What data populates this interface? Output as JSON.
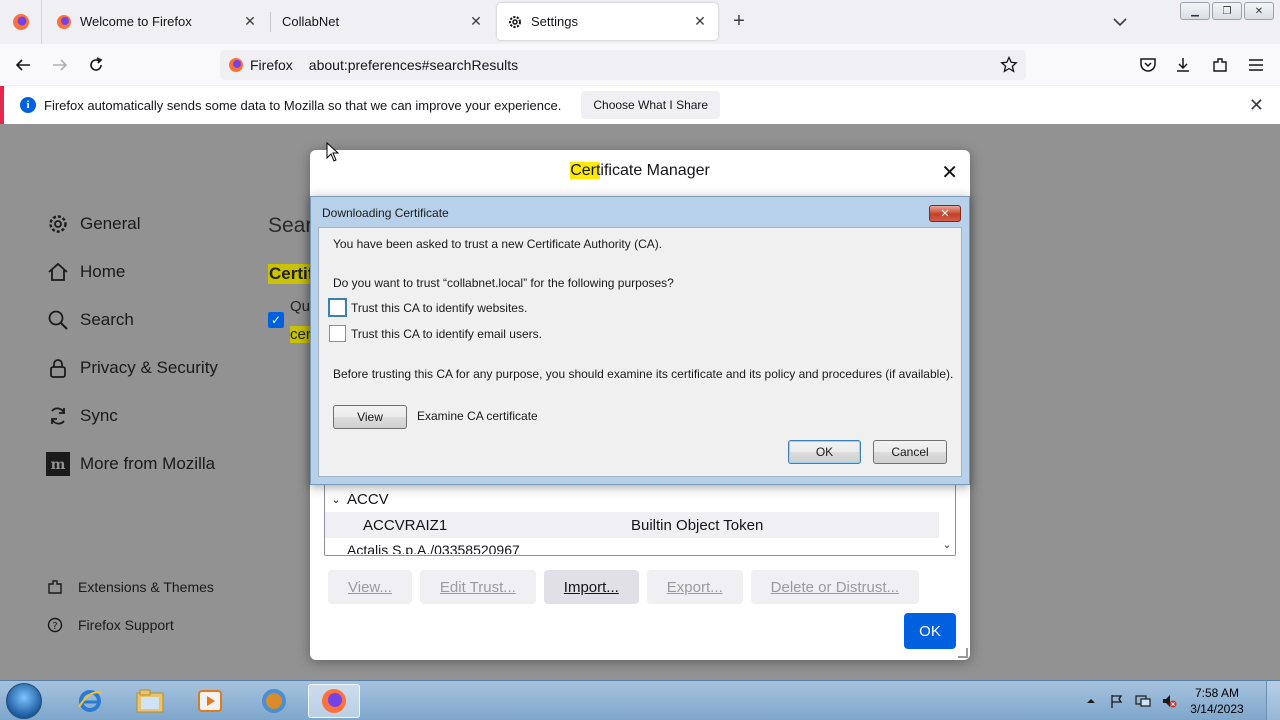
{
  "tabs": [
    {
      "title": "Welcome to Firefox",
      "icon": "firefox-icon",
      "selected": false
    },
    {
      "title": "CollabNet",
      "icon": "",
      "selected": false
    },
    {
      "title": "Settings",
      "icon": "gear-icon",
      "selected": true
    }
  ],
  "navbar": {
    "identity_label": "Firefox",
    "url": "about:preferences#searchResults"
  },
  "notification": {
    "text": "Firefox automatically sends some data to Mozilla so that we can improve your experience.",
    "button": "Choose What I Share"
  },
  "prefs": {
    "categories": [
      {
        "label": "General",
        "icon": "gear-icon"
      },
      {
        "label": "Home",
        "icon": "home-icon"
      },
      {
        "label": "Search",
        "icon": "search-icon"
      },
      {
        "label": "Privacy & Security",
        "icon": "lock-icon"
      },
      {
        "label": "Sync",
        "icon": "sync-icon"
      },
      {
        "label": "More from Mozilla",
        "icon": "mozilla-icon"
      }
    ],
    "footer": [
      {
        "label": "Extensions & Themes",
        "icon": "puzzle-icon"
      },
      {
        "label": "Firefox Support",
        "icon": "help-icon"
      }
    ],
    "heading_partial": "Sear",
    "subheading_partial": "Certif",
    "option_text1": "Qu",
    "option_text2": "cer"
  },
  "cert_manager": {
    "title_highlight": "Cert",
    "title_rest": "ificate Manager",
    "tree": {
      "group": "ACCV",
      "rows": [
        {
          "name": "ACCVRAIZ1",
          "device": "Builtin Object Token"
        }
      ],
      "partial_next": "Actalis S.p.A./03358520967"
    },
    "buttons": [
      "View...",
      "Edit Trust...",
      "Import...",
      "Export...",
      "Delete or Distrust..."
    ],
    "ok": "OK"
  },
  "download_dialog": {
    "title": "Downloading Certificate",
    "intro": "You have been asked to trust a new Certificate Authority (CA).",
    "question": "Do you want to trust “collabnet.local” for the following purposes?",
    "options": [
      {
        "label": "Trust this CA to identify websites.",
        "checked": false
      },
      {
        "label": "Trust this CA to identify email users.",
        "checked": false
      }
    ],
    "advice": "Before trusting this CA for any purpose, you should examine its certificate and its policy and procedures (if available).",
    "view_button": "View",
    "view_label": "Examine CA certificate",
    "ok": "OK",
    "cancel": "Cancel"
  },
  "taskbar": {
    "time": "7:58 AM",
    "date": "3/14/2023"
  }
}
